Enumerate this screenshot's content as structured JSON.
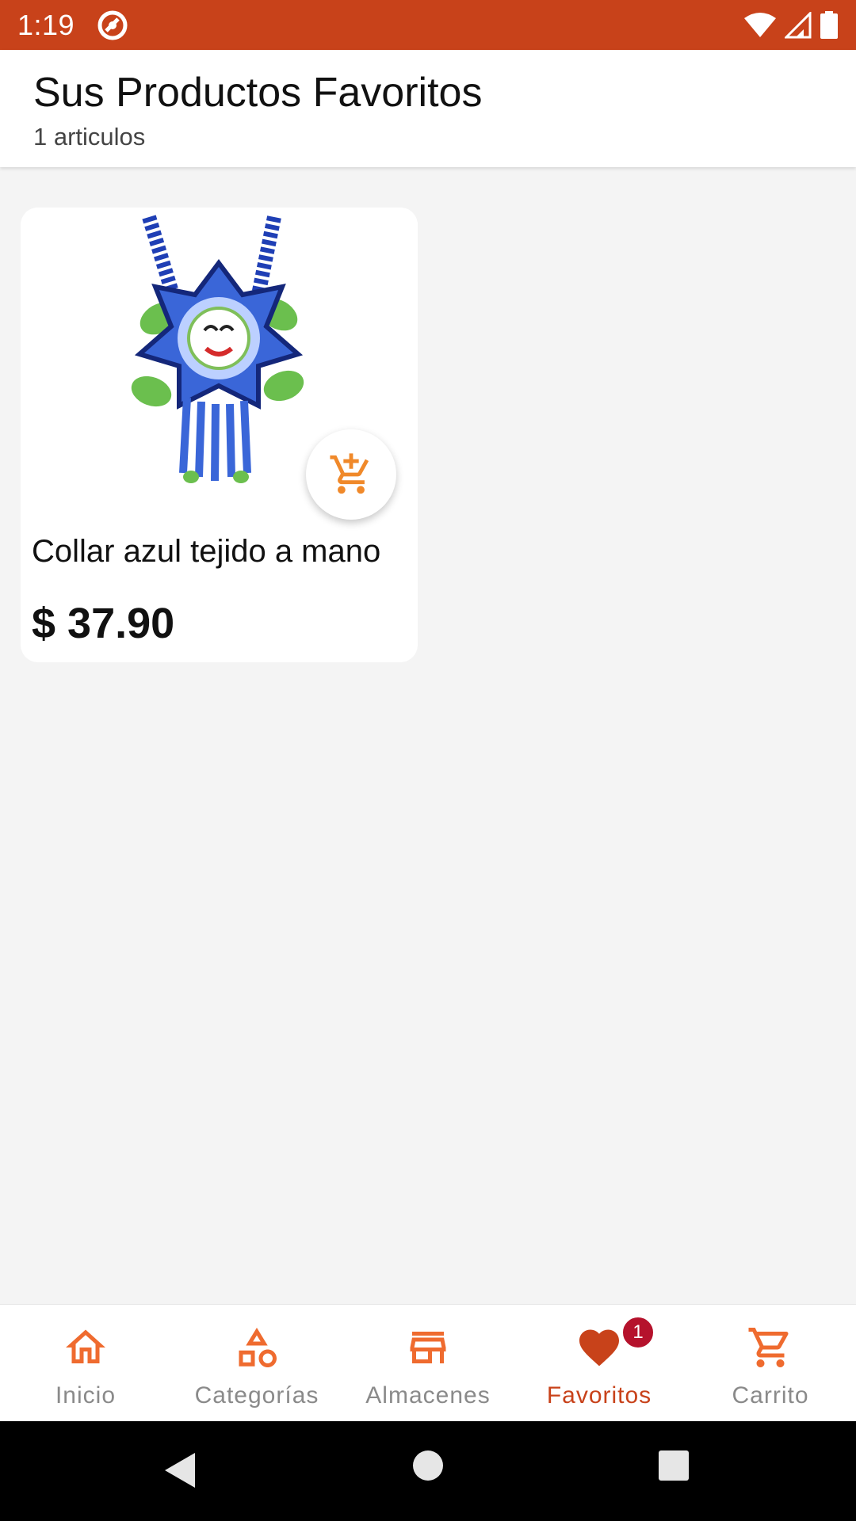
{
  "status_bar": {
    "time": "1:19",
    "icons": [
      "app-notification-icon",
      "wifi-icon",
      "signal-icon",
      "battery-icon"
    ]
  },
  "header": {
    "title": "Sus Productos Favoritos",
    "subtitle": "1 articulos"
  },
  "products": [
    {
      "name": "Collar azul tejido a mano",
      "price": "$ 37.90",
      "image": "blue-beaded-necklace-image",
      "action_icon": "add-to-cart-icon"
    }
  ],
  "bottom_nav": {
    "items": [
      {
        "label": "Inicio",
        "icon": "home-icon"
      },
      {
        "label": "Categorías",
        "icon": "categories-icon"
      },
      {
        "label": "Almacenes",
        "icon": "store-icon"
      },
      {
        "label": "Favoritos",
        "icon": "heart-icon",
        "badge": "1",
        "active": true
      },
      {
        "label": "Carrito",
        "icon": "cart-icon"
      }
    ]
  },
  "colors": {
    "primary": "#c8421a",
    "accent": "#ef6b2f",
    "badge": "#b5122c",
    "inactive_label": "#8a8a8a",
    "cart_button_icon": "#f0892a"
  },
  "system_nav": {
    "icons": [
      "back-icon",
      "home-circle-icon",
      "recents-icon"
    ]
  }
}
